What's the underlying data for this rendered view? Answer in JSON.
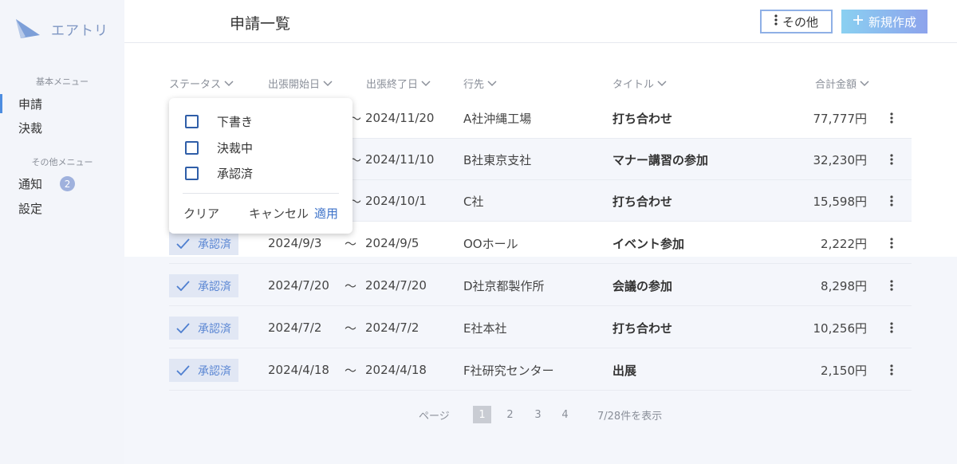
{
  "brand": {
    "name": "エアトリ"
  },
  "sidebar": {
    "basic_section": "基本メニュー",
    "other_section": "その他メニュー",
    "items": [
      {
        "label": "申請",
        "active": true
      },
      {
        "label": "決裁"
      },
      {
        "label": "通知",
        "badge": "2"
      },
      {
        "label": "設定"
      }
    ]
  },
  "header": {
    "title": "申請一覧",
    "other_button": "その他",
    "new_button": "新規作成"
  },
  "table": {
    "columns": [
      "ステータス",
      "出張開始日",
      "出張終了日",
      "行先",
      "タイトル",
      "合計金額"
    ],
    "separator": "〜",
    "rows": [
      {
        "status": "",
        "start": "",
        "end": "2024/11/20",
        "dest": "A社沖縄工場",
        "title": "打ち合わせ",
        "amount": "77,777円"
      },
      {
        "status": "",
        "start": "",
        "end": "2024/11/10",
        "dest": "B社東京支社",
        "title": "マナー講習の参加",
        "amount": "32,230円"
      },
      {
        "status": "",
        "start": "",
        "end": "2024/10/1",
        "dest": "C社",
        "title": "打ち合わせ",
        "amount": "15,598円"
      },
      {
        "status": "承認済",
        "start": "2024/9/3",
        "end": "2024/9/5",
        "dest": "OOホール",
        "title": "イベント参加",
        "amount": "2,222円"
      },
      {
        "status": "承認済",
        "start": "2024/7/20",
        "end": "2024/7/20",
        "dest": "D社京都製作所",
        "title": "会議の参加",
        "amount": "8,298円"
      },
      {
        "status": "承認済",
        "start": "2024/7/2",
        "end": "2024/7/2",
        "dest": "E社本社",
        "title": "打ち合わせ",
        "amount": "10,256円"
      },
      {
        "status": "承認済",
        "start": "2024/4/18",
        "end": "2024/4/18",
        "dest": "F社研究センター",
        "title": "出展",
        "amount": "2,150円"
      }
    ]
  },
  "status_filter": {
    "options": [
      "下書き",
      "決裁中",
      "承認済"
    ],
    "clear": "クリア",
    "cancel": "キャンセル",
    "apply": "適用"
  },
  "pagination": {
    "label": "ページ",
    "pages": [
      "1",
      "2",
      "3",
      "4"
    ],
    "current": "1",
    "summary": "7/28件を表示"
  },
  "colors": {
    "accent": "#4d8de0",
    "chip_bg": "#e1e7f4",
    "chip_text": "#5a86d3",
    "new_button_gradient": [
      "#8ad0f1",
      "#8da3ec"
    ]
  }
}
